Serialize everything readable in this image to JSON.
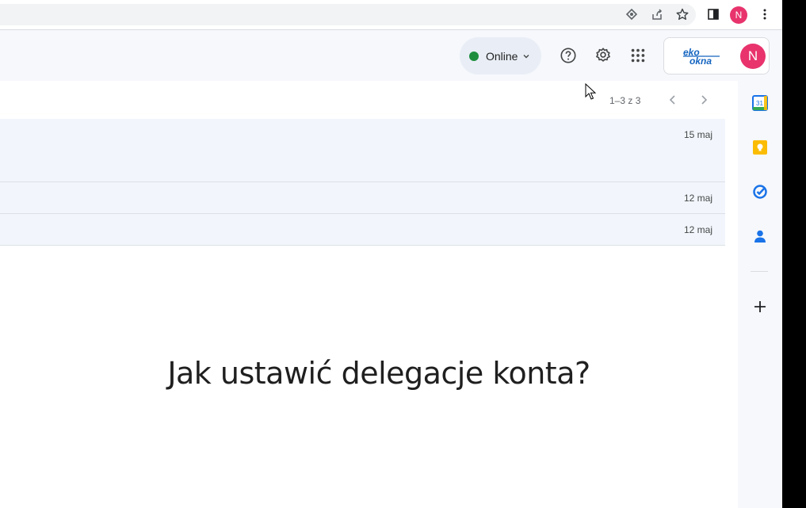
{
  "browser": {
    "avatar_initial": "N",
    "icons": [
      "extension-icon",
      "share-icon",
      "bookmark-star-icon",
      "side-panel-icon",
      "more-vert-icon"
    ]
  },
  "header": {
    "status": {
      "label": "Online",
      "color": "#1e8e3e"
    },
    "icons": [
      "help-icon",
      "settings-icon",
      "apps-grid-icon"
    ],
    "account": {
      "logo": "eko okna logo",
      "avatar_initial": "N",
      "avatar_color": "#e8336d"
    }
  },
  "pager": {
    "range": "1–3 z 3"
  },
  "mail_rows": [
    {
      "date": "15 maj"
    },
    {
      "date": "12 maj"
    },
    {
      "date": "12 maj"
    }
  ],
  "caption": "Jak ustawić delegacje konta?",
  "side_panel": {
    "icons": [
      "calendar-icon",
      "keep-icon",
      "tasks-icon",
      "contacts-icon",
      "add-icon"
    ],
    "calendar_number": "31"
  }
}
